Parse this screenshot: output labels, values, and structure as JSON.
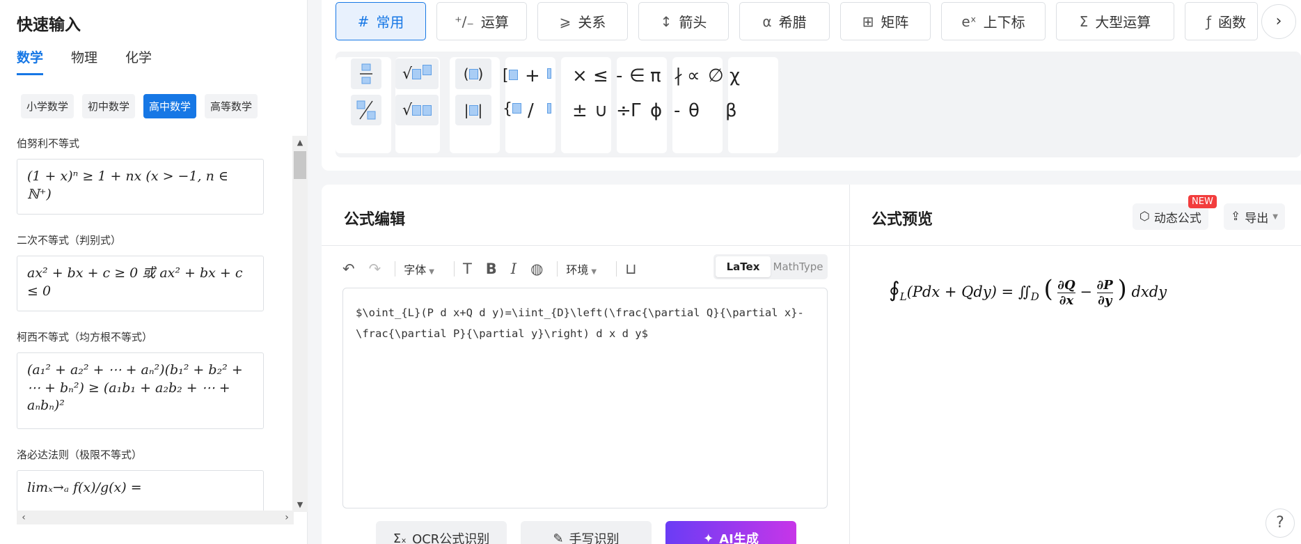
{
  "quick_input": {
    "title": "快速输入",
    "subject_tabs": [
      "数学",
      "物理",
      "化学"
    ],
    "level_pills": [
      "小学数学",
      "初中数学",
      "高中数学",
      "高等数学"
    ],
    "formulas": [
      {
        "name": "伯努利不等式",
        "expr": "(1 + x)ⁿ ≥ 1 + nx   (x > −1, n ∈ ℕ⁺)"
      },
      {
        "name": "二次不等式（判别式）",
        "expr": "ax² + bx + c ≥ 0 或 ax² + bx + c ≤ 0"
      },
      {
        "name": "柯西不等式（均方根不等式）",
        "expr": "(a₁² + a₂² + ⋯ + aₙ²)(b₁² + b₂² + ⋯ + bₙ²) ≥ (a₁b₁ + a₂b₂ + ⋯ + aₙbₙ)²"
      },
      {
        "name": "洛必达法则（极限不等式）",
        "expr": "limₓ→ₐ f(x)/g(x) ="
      }
    ]
  },
  "symbol_panel": {
    "categories": [
      {
        "icon": "#",
        "label": "常用"
      },
      {
        "icon": "⁺∕₋",
        "label": "运算"
      },
      {
        "icon": "⩾",
        "label": "关系"
      },
      {
        "icon": "↕",
        "label": "箭头"
      },
      {
        "icon": "α",
        "label": "希腊"
      },
      {
        "icon": "⊞",
        "label": "矩阵"
      },
      {
        "icon": "eˣ",
        "label": "上下标"
      },
      {
        "icon": "Σ",
        "label": "大型运算"
      },
      {
        "icon": "ƒ",
        "label": "函数"
      }
    ],
    "row1_symbols": [
      "+",
      "×",
      "≤",
      "-",
      "∈",
      "π",
      "∤",
      "∝",
      "∅",
      "χ"
    ],
    "row2_symbols": [
      "/",
      "±",
      "∪",
      "÷",
      "Γ",
      "ϕ",
      "-",
      "θ",
      "β"
    ]
  },
  "editor": {
    "title": "公式编辑",
    "font_label": "字体",
    "env_label": "环境",
    "modes": [
      "LaTex",
      "MathType"
    ],
    "latex_line1": "$\\oint_{L}(P d x+Q d y)=\\iint_{D}\\left(\\frac{\\partial Q}{\\partial x}-",
    "latex_line2": "\\frac{\\partial P}{\\partial y}\\right) d x d y$",
    "buttons": {
      "ocr": "OCR公式识别",
      "handwrite": "手写识别",
      "ai": "AI生成"
    }
  },
  "preview": {
    "title": "公式预览",
    "dynamic_label": "动态公式",
    "new_badge": "NEW",
    "export_label": "导出",
    "lhs": "∮",
    "lhs_sub": "L",
    "lhs_body": "(Pdx + Qdy) = ∬",
    "rhs_sub": "D",
    "frac1_num": "∂Q",
    "frac1_den": "∂x",
    "frac2_num": "∂P",
    "frac2_den": "∂y",
    "tail": "dxdy"
  },
  "help_label": "?"
}
